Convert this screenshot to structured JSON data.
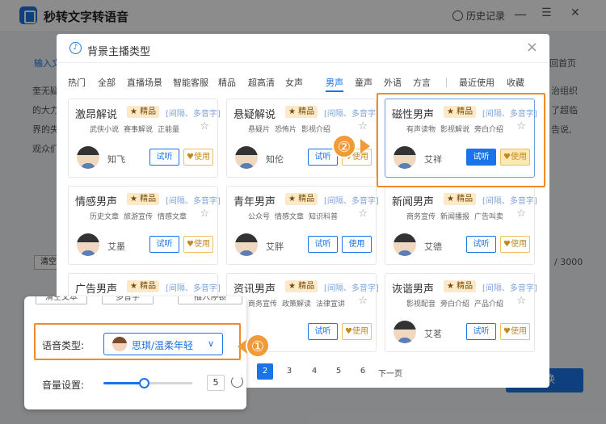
{
  "app": {
    "title": "秒转文字转语音",
    "history_label": "历史记录",
    "minimize_glyph": "—",
    "menu_glyph": "☰",
    "close_glyph": "✕",
    "colors": {
      "accent": "#1a73e8",
      "highlight": "#f08c28",
      "badge_bg": "#fbe9c9"
    }
  },
  "background": {
    "input_tab": "输入文",
    "text_line_1": "奎无疑",
    "text_line_2": "的大力",
    "text_line_3": "界的失",
    "text_line_4": "观众们",
    "right_line_1": "治组织",
    "right_line_2": "了超临",
    "right_line_3": "告说,",
    "back_home": "回首页",
    "clear_btn": "清空文",
    "char_count": "/ 3000",
    "convert_btn": "转换"
  },
  "dialog": {
    "title": "背景主播类型",
    "categories": [
      "热门",
      "全部",
      "直播场景",
      "智能客服",
      "精品",
      "超高清",
      "女声",
      "男声",
      "童声",
      "外语",
      "方言",
      "最近使用",
      "收藏"
    ],
    "active_category": "男声",
    "cards": [
      {
        "name": "激昂解说",
        "badge": "★ 精品",
        "attr": "[间隔、多音字]",
        "tags": [
          "武侠小说",
          "赛事解说",
          "正能量"
        ],
        "voice": "知飞",
        "try_label": "试听",
        "use_label": "使用"
      },
      {
        "name": "悬疑解说",
        "badge": "★ 精品",
        "attr": "[间隔、多音字]",
        "tags": [
          "悬疑片",
          "恐怖片",
          "影视介绍"
        ],
        "voice": "知伦",
        "try_label": "试听",
        "use_label": "使用"
      },
      {
        "name": "磁性男声",
        "badge": "★ 精品",
        "attr": "[间隔、多音字]",
        "tags": [
          "有声读物",
          "影视解说",
          "旁白介绍"
        ],
        "voice": "艾祥",
        "try_label": "试听",
        "use_label": "使用"
      },
      {
        "name": "情感男声",
        "badge": "★ 精品",
        "attr": "[间隔、多音字]",
        "tags": [
          "历史文章",
          "旅游宣传",
          "情感文章"
        ],
        "voice": "艾墨",
        "try_label": "试听",
        "use_label": "使用"
      },
      {
        "name": "青年男声",
        "badge": "★ 精品",
        "attr": "[间隔、多音字]",
        "tags": [
          "公众号",
          "情感文章",
          "知识科普"
        ],
        "voice": "艾胖",
        "try_label": "试听",
        "use_label": "使用"
      },
      {
        "name": "新闻男声",
        "badge": "★ 精品",
        "attr": "[间隔、多音字]",
        "tags": [
          "商务宣传",
          "新闻播报",
          "广告叫卖"
        ],
        "voice": "艾德",
        "try_label": "试听",
        "use_label": "使用"
      },
      {
        "name": "广告男声",
        "badge": "★ 精品",
        "attr": "[间隔、多音字]",
        "tags": [],
        "voice": "",
        "try_label": "",
        "use_label": ""
      },
      {
        "name": "资讯男声",
        "badge": "★ 精品",
        "attr": "[间隔、多音字]",
        "tags": [
          "商务宣传",
          "政策解读",
          "法律宣讲"
        ],
        "voice": "",
        "try_label": "试听",
        "use_label": "使用"
      },
      {
        "name": "诙谐男声",
        "badge": "★ 精品",
        "attr": "[间隔、多音字]",
        "tags": [
          "影视配音",
          "旁白介绍",
          "产品介绍"
        ],
        "voice": "艾茗",
        "try_label": "试听",
        "use_label": "使用"
      }
    ],
    "pagination": {
      "pages": [
        "2",
        "3",
        "4",
        "5",
        "6"
      ],
      "active": "2",
      "next_label": "下一页"
    }
  },
  "callouts": {
    "one": "①",
    "two": "②"
  },
  "settings_zoom": {
    "top_buttons": [
      "清空文本",
      "多音字",
      "插入停顿"
    ],
    "voice_type_label": "语音类型:",
    "voice_type_value": "思琪/温柔年轻",
    "volume_label": "音量设置:",
    "volume_value": "5",
    "volume_fraction": 0.45
  }
}
